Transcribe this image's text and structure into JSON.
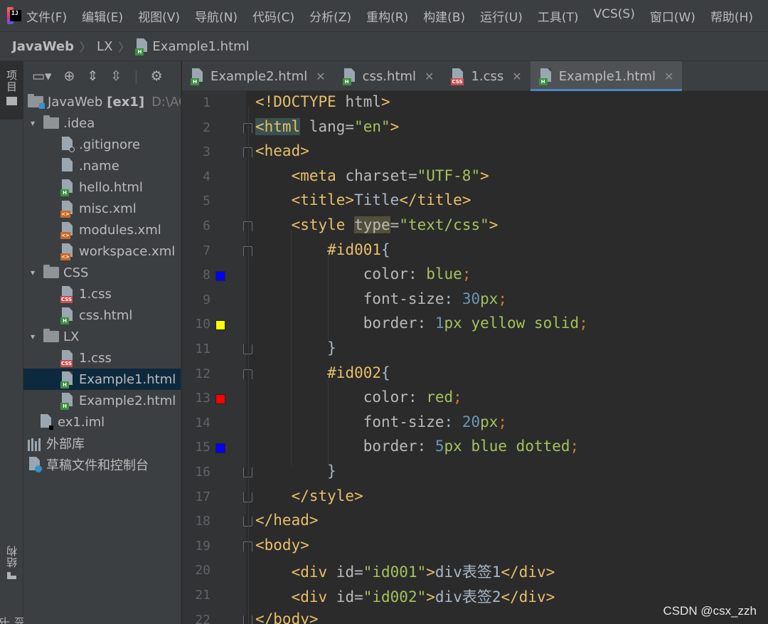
{
  "menu": [
    "文件(F)",
    "编辑(E)",
    "视图(V)",
    "导航(N)",
    "代码(C)",
    "分析(Z)",
    "重构(R)",
    "构建(B)",
    "运行(U)",
    "工具(T)",
    "VCS(S)",
    "窗口(W)",
    "帮助(H)"
  ],
  "breadcrumb": [
    "JavaWeb",
    "LX",
    "Example1.html"
  ],
  "stripe": {
    "project": "项目",
    "structure": "结构",
    "bookmarks": "书签"
  },
  "tree": [
    {
      "label": "JavaWeb",
      "extra": "[ex1]",
      "path": "D:\\AC",
      "icon": "module-folder",
      "arrow": "",
      "indent": 0
    },
    {
      "label": ".idea",
      "icon": "folder",
      "arrow": "▾",
      "indent": 1
    },
    {
      "label": ".gitignore",
      "icon": "gitignore-file-icon",
      "arrow": "",
      "indent": 2
    },
    {
      "label": ".name",
      "icon": "text-file-icon",
      "arrow": "",
      "indent": 2
    },
    {
      "label": "hello.html",
      "icon": "html-file-icon",
      "arrow": "",
      "indent": 2
    },
    {
      "label": "misc.xml",
      "icon": "xml-file-icon",
      "arrow": "",
      "indent": 2
    },
    {
      "label": "modules.xml",
      "icon": "xml-file-icon",
      "arrow": "",
      "indent": 2
    },
    {
      "label": "workspace.xml",
      "icon": "xml-file-icon",
      "arrow": "",
      "indent": 2
    },
    {
      "label": "CSS",
      "icon": "folder",
      "arrow": "▾",
      "indent": 1
    },
    {
      "label": "1.css",
      "icon": "css-file-icon",
      "arrow": "",
      "indent": 2
    },
    {
      "label": "css.html",
      "icon": "html-file-icon",
      "arrow": "",
      "indent": 2
    },
    {
      "label": "LX",
      "icon": "folder",
      "arrow": "▾",
      "indent": 1
    },
    {
      "label": "1.css",
      "icon": "css-file-icon",
      "arrow": "",
      "indent": 2
    },
    {
      "label": "Example1.html",
      "icon": "html-file-icon",
      "arrow": "",
      "indent": 2,
      "selected": true
    },
    {
      "label": "Example2.html",
      "icon": "html-file-icon",
      "arrow": "",
      "indent": 2
    },
    {
      "label": "ex1.iml",
      "icon": "iml-file-icon",
      "arrow": "",
      "indent": 1
    },
    {
      "label": "外部库",
      "icon": "library-icon",
      "arrow": "",
      "indent": 0
    },
    {
      "label": "草稿文件和控制台",
      "icon": "scratch-icon",
      "arrow": "",
      "indent": 0
    }
  ],
  "tabs": [
    {
      "label": "Example2.html",
      "icon": "html",
      "active": false
    },
    {
      "label": "css.html",
      "icon": "html",
      "active": false
    },
    {
      "label": "1.css",
      "icon": "css",
      "active": false
    },
    {
      "label": "Example1.html",
      "icon": "html",
      "active": true
    }
  ],
  "colors": {
    "blue": "#0000ff",
    "yellow": "#ffff00",
    "red": "#ff0000",
    "accent": "#4a88c7"
  },
  "code": [
    [
      [
        "t",
        "<!DOCTYPE "
      ],
      [
        "a",
        "html"
      ],
      [
        "t",
        ">"
      ]
    ],
    [
      [
        "t hl-tag",
        "<html"
      ],
      [
        "a",
        " lang="
      ],
      [
        "s",
        "\"en\""
      ],
      [
        "t",
        ">"
      ]
    ],
    [
      [
        "t",
        "<head>"
      ]
    ],
    [
      [
        "c",
        "    "
      ],
      [
        "t",
        "<meta"
      ],
      [
        "a",
        " charset="
      ],
      [
        "s",
        "\"UTF-8\""
      ],
      [
        "t",
        ">"
      ]
    ],
    [
      [
        "c",
        "    "
      ],
      [
        "t",
        "<title>"
      ],
      [
        "c",
        "Title"
      ],
      [
        "t",
        "</title>"
      ]
    ],
    [
      [
        "c",
        "    "
      ],
      [
        "t",
        "<style"
      ],
      [
        "a",
        " "
      ],
      [
        "a hl-attr",
        "type"
      ],
      [
        "a",
        "="
      ],
      [
        "s",
        "\"text/css\""
      ],
      [
        "t",
        ">"
      ]
    ],
    [
      [
        "c",
        "        "
      ],
      [
        "sel",
        "#id001"
      ],
      [
        "c",
        "{"
      ]
    ],
    [
      [
        "c",
        "            "
      ],
      [
        "a",
        "color"
      ],
      [
        "c",
        ": "
      ],
      [
        "s",
        "blue"
      ],
      [
        "p",
        ";"
      ]
    ],
    [
      [
        "c",
        "            "
      ],
      [
        "a",
        "font-size"
      ],
      [
        "c",
        ": "
      ],
      [
        "n",
        "30"
      ],
      [
        "s",
        "px"
      ],
      [
        "p",
        ";"
      ]
    ],
    [
      [
        "c",
        "            "
      ],
      [
        "a",
        "border"
      ],
      [
        "c",
        ": "
      ],
      [
        "n",
        "1"
      ],
      [
        "s",
        "px yellow solid"
      ],
      [
        "p",
        ";"
      ]
    ],
    [
      [
        "c",
        "        }"
      ]
    ],
    [
      [
        "c",
        "        "
      ],
      [
        "sel",
        "#id002"
      ],
      [
        "c",
        "{"
      ]
    ],
    [
      [
        "c",
        "            "
      ],
      [
        "a",
        "color"
      ],
      [
        "c",
        ": "
      ],
      [
        "s",
        "red"
      ],
      [
        "p",
        ";"
      ]
    ],
    [
      [
        "c",
        "            "
      ],
      [
        "a",
        "font-size"
      ],
      [
        "c",
        ": "
      ],
      [
        "n",
        "20"
      ],
      [
        "s",
        "px"
      ],
      [
        "p",
        ";"
      ]
    ],
    [
      [
        "c",
        "            "
      ],
      [
        "a",
        "border"
      ],
      [
        "c",
        ": "
      ],
      [
        "n",
        "5"
      ],
      [
        "s",
        "px blue dotted"
      ],
      [
        "p",
        ";"
      ]
    ],
    [
      [
        "c",
        "        }"
      ]
    ],
    [
      [
        "c",
        "    "
      ],
      [
        "t",
        "</style>"
      ]
    ],
    [
      [
        "t",
        "</head>"
      ]
    ],
    [
      [
        "t",
        "<body>"
      ]
    ],
    [
      [
        "c",
        "    "
      ],
      [
        "t",
        "<div"
      ],
      [
        "a",
        " id="
      ],
      [
        "s",
        "\"id001\""
      ],
      [
        "t",
        ">"
      ],
      [
        "c",
        "div表签1"
      ],
      [
        "t",
        "</div>"
      ]
    ],
    [
      [
        "c",
        "    "
      ],
      [
        "t",
        "<div"
      ],
      [
        "a",
        " id="
      ],
      [
        "s",
        "\"id002\""
      ],
      [
        "t",
        ">"
      ],
      [
        "c",
        "div表签2"
      ],
      [
        "t",
        "</div>"
      ]
    ],
    [
      [
        "t",
        "</body>"
      ]
    ]
  ],
  "swatches": [
    {
      "line": 8,
      "color": "#0000ff"
    },
    {
      "line": 10,
      "color": "#ffff00"
    },
    {
      "line": 13,
      "color": "#ff0000"
    },
    {
      "line": 15,
      "color": "#0000ff"
    }
  ],
  "folds": [
    {
      "line": 2,
      "kind": "open"
    },
    {
      "line": 3,
      "kind": "open"
    },
    {
      "line": 6,
      "kind": "open"
    },
    {
      "line": 7,
      "kind": "open"
    },
    {
      "line": 11,
      "kind": "close"
    },
    {
      "line": 12,
      "kind": "open"
    },
    {
      "line": 16,
      "kind": "close"
    },
    {
      "line": 17,
      "kind": "close"
    },
    {
      "line": 18,
      "kind": "close"
    },
    {
      "line": 19,
      "kind": "open"
    },
    {
      "line": 22,
      "kind": "close"
    }
  ],
  "watermark": "CSDN @csx_zzh"
}
